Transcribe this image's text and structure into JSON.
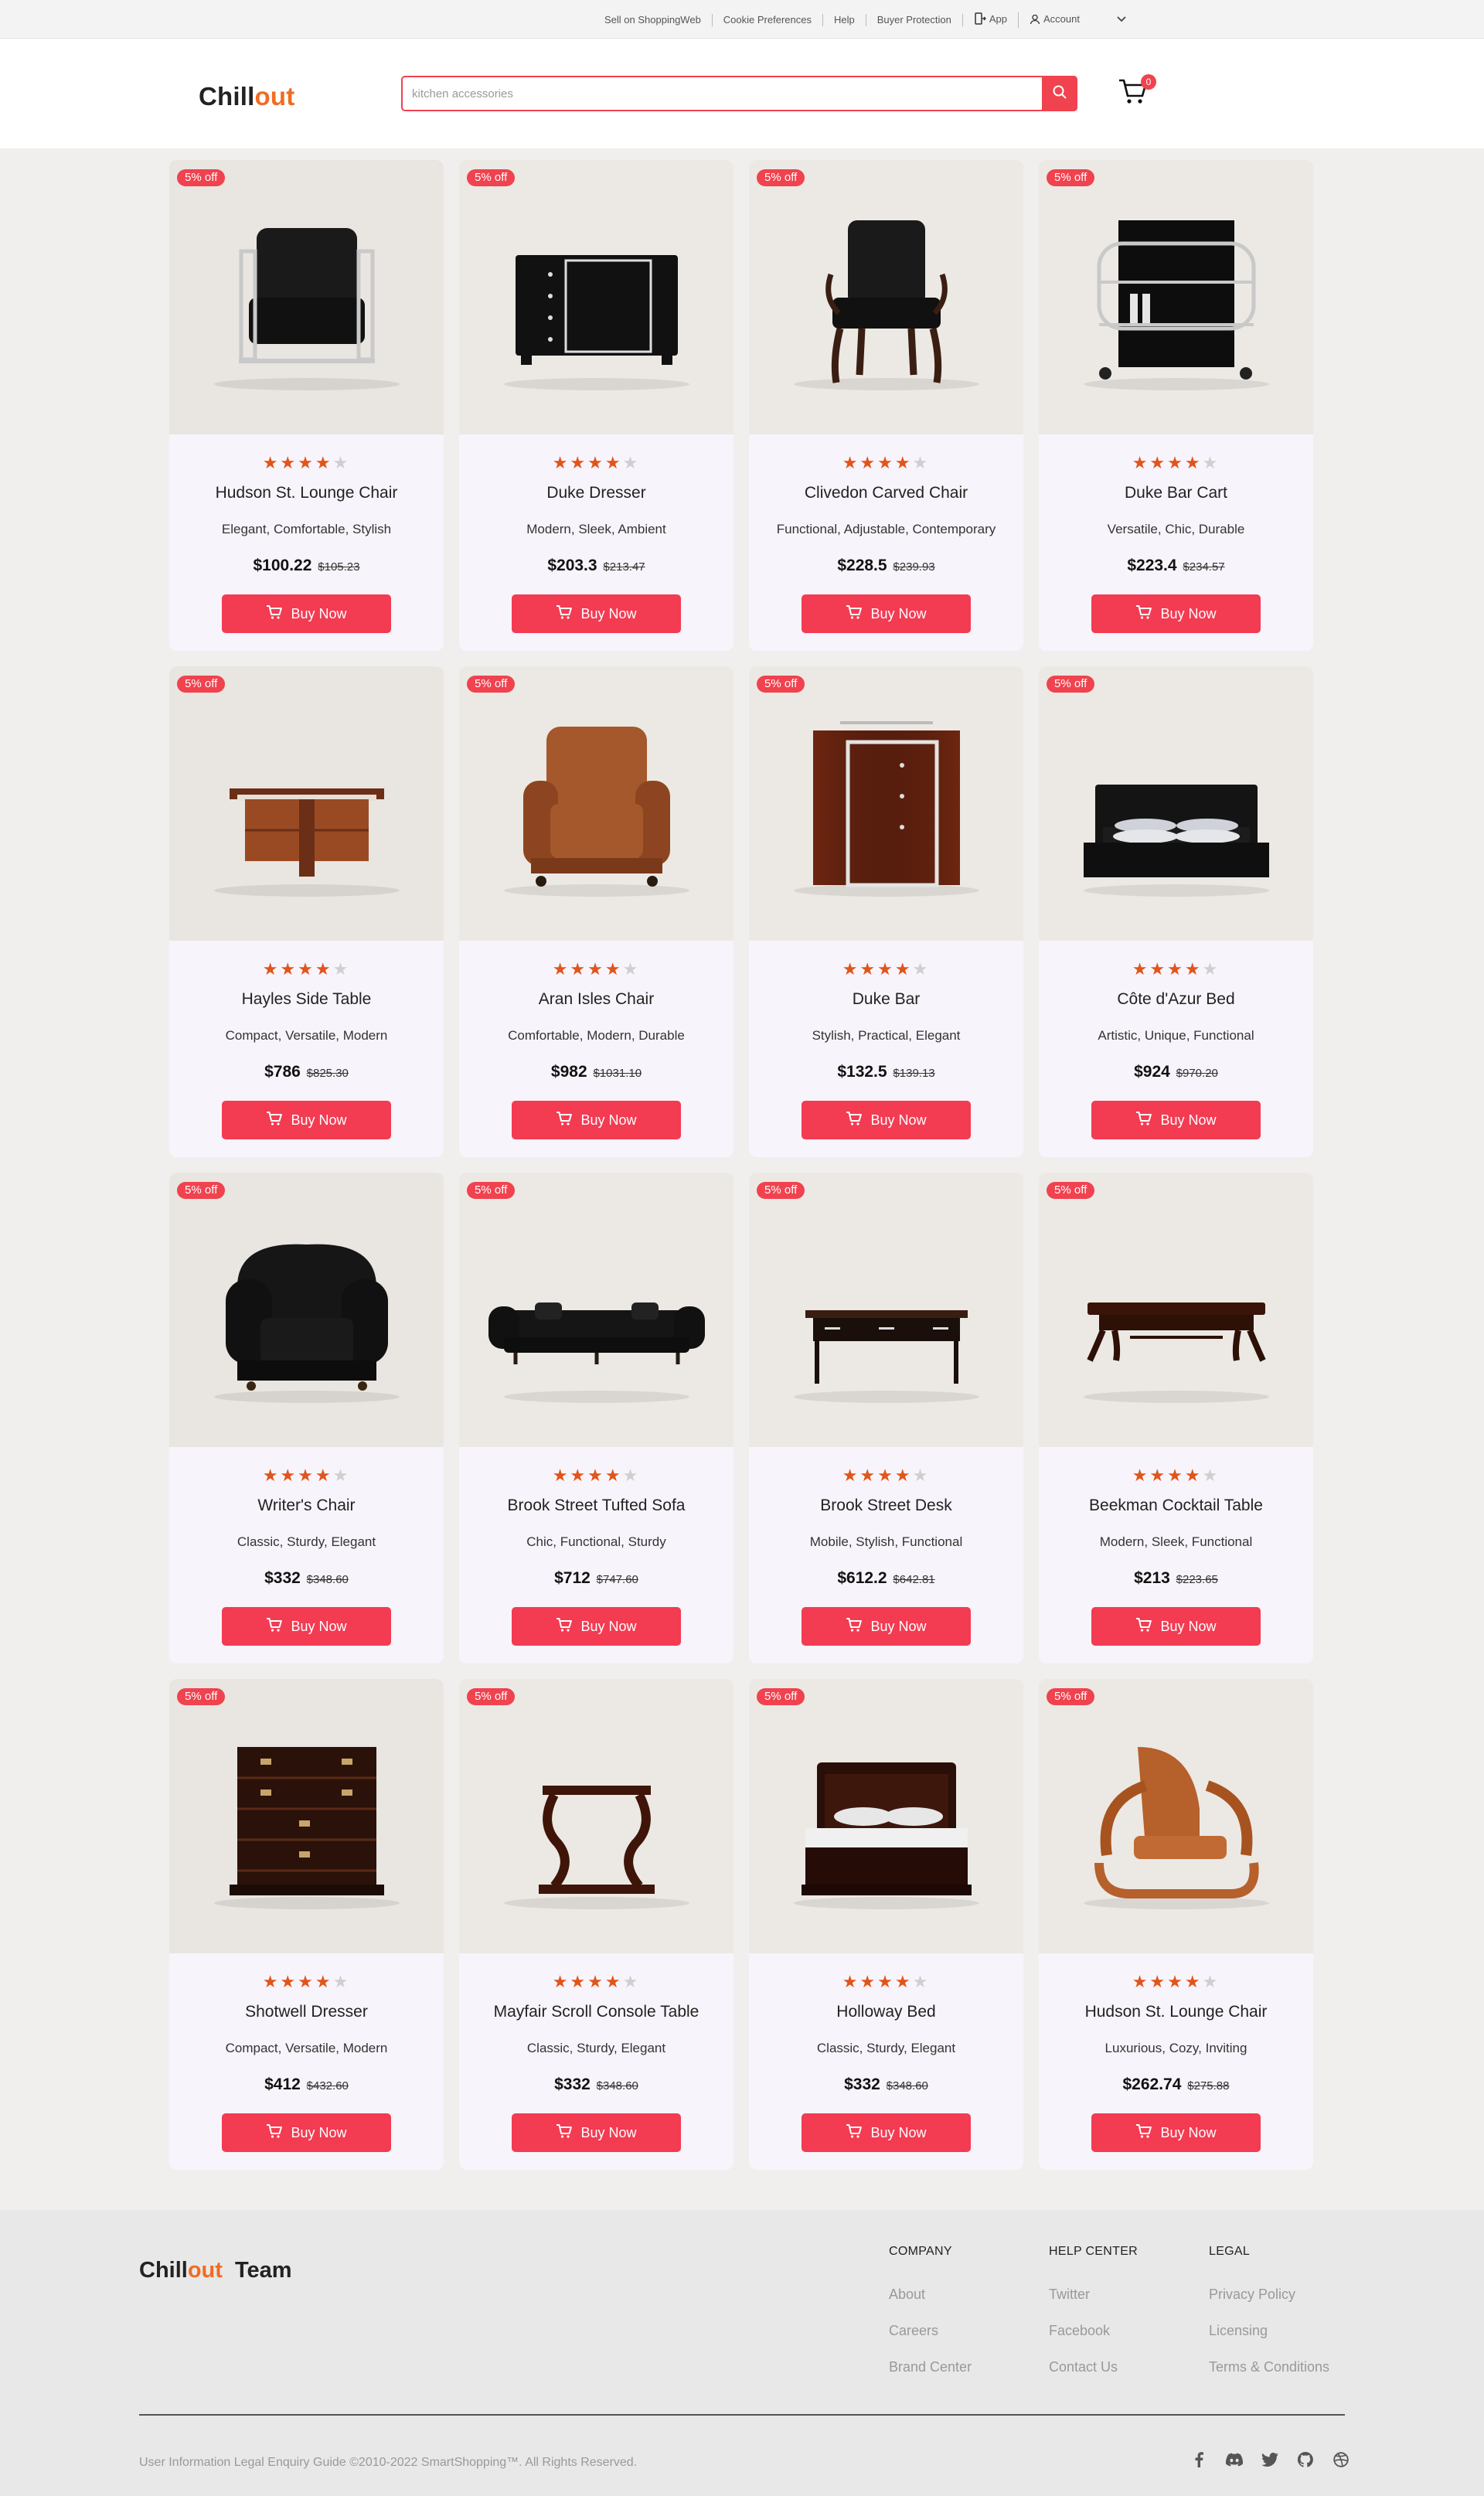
{
  "topbar": {
    "sell": "Sell on ShoppingWeb",
    "cookie": "Cookie Preferences",
    "help": "Help",
    "buyer": "Buyer Protection",
    "app": "App",
    "account": "Account"
  },
  "header": {
    "logo_a": "Chill",
    "logo_b": "out",
    "search_placeholder": "kitchen accessories",
    "cart_count": "0"
  },
  "colors": {
    "accent": "#f33b52",
    "brand_orange": "#f26b21",
    "star": "#e1541a"
  },
  "products": [
    {
      "badge": "5% off",
      "name": "Hudson St. Lounge Chair",
      "tags": "Elegant, Comfortable, Stylish",
      "price": "$100.22",
      "old": "$105.23",
      "rating": 4,
      "buy": "Buy Now",
      "kind": "lounge-black"
    },
    {
      "badge": "5% off",
      "name": "Duke Dresser",
      "tags": "Modern, Sleek, Ambient",
      "price": "$203.3",
      "old": "$213.47",
      "rating": 4,
      "buy": "Buy Now",
      "kind": "dresser-black"
    },
    {
      "badge": "5% off",
      "name": "Clivedon Carved Chair",
      "tags": "Functional, Adjustable, Contemporary",
      "price": "$228.5",
      "old": "$239.93",
      "rating": 4,
      "buy": "Buy Now",
      "kind": "carved-chair"
    },
    {
      "badge": "5% off",
      "name": "Duke Bar Cart",
      "tags": "Versatile, Chic, Durable",
      "price": "$223.4",
      "old": "$234.57",
      "rating": 4,
      "buy": "Buy Now",
      "kind": "bar-cart"
    },
    {
      "badge": "5% off",
      "name": "Hayles Side Table",
      "tags": "Compact, Versatile, Modern",
      "price": "$786",
      "old": "$825.30",
      "rating": 4,
      "buy": "Buy Now",
      "kind": "side-table"
    },
    {
      "badge": "5% off",
      "name": "Aran Isles Chair",
      "tags": "Comfortable, Modern, Durable",
      "price": "$982",
      "old": "$1031.10",
      "rating": 4,
      "buy": "Buy Now",
      "kind": "armchair-brown"
    },
    {
      "badge": "5% off",
      "name": "Duke Bar",
      "tags": "Stylish, Practical, Elegant",
      "price": "$132.5",
      "old": "$139.13",
      "rating": 4,
      "buy": "Buy Now",
      "kind": "bar-cabinet"
    },
    {
      "badge": "5% off",
      "name": "Côte d'Azur Bed",
      "tags": "Artistic, Unique, Functional",
      "price": "$924",
      "old": "$970.20",
      "rating": 4,
      "buy": "Buy Now",
      "kind": "bed-black"
    },
    {
      "badge": "5% off",
      "name": "Writer's Chair",
      "tags": "Classic, Sturdy, Elegant",
      "price": "$332",
      "old": "$348.60",
      "rating": 4,
      "buy": "Buy Now",
      "kind": "tufted-chair"
    },
    {
      "badge": "5% off",
      "name": "Brook Street Tufted Sofa",
      "tags": "Chic, Functional, Sturdy",
      "price": "$712",
      "old": "$747.60",
      "rating": 4,
      "buy": "Buy Now",
      "kind": "sofa"
    },
    {
      "badge": "5% off",
      "name": "Brook Street Desk",
      "tags": "Mobile, Stylish, Functional",
      "price": "$612.2",
      "old": "$642.81",
      "rating": 4,
      "buy": "Buy Now",
      "kind": "desk"
    },
    {
      "badge": "5% off",
      "name": "Beekman Cocktail Table",
      "tags": "Modern, Sleek, Functional",
      "price": "$213",
      "old": "$223.65",
      "rating": 4,
      "buy": "Buy Now",
      "kind": "cocktail-table"
    },
    {
      "badge": "5% off",
      "name": "Shotwell Dresser",
      "tags": "Compact, Versatile, Modern",
      "price": "$412",
      "old": "$432.60",
      "rating": 4,
      "buy": "Buy Now",
      "kind": "chest"
    },
    {
      "badge": "5% off",
      "name": "Mayfair Scroll Console Table",
      "tags": "Classic, Sturdy, Elegant",
      "price": "$332",
      "old": "$348.60",
      "rating": 4,
      "buy": "Buy Now",
      "kind": "console"
    },
    {
      "badge": "5% off",
      "name": "Holloway Bed",
      "tags": "Classic, Sturdy, Elegant",
      "price": "$332",
      "old": "$348.60",
      "rating": 4,
      "buy": "Buy Now",
      "kind": "bed-wood"
    },
    {
      "badge": "5% off",
      "name": "Hudson St. Lounge Chair",
      "tags": "Luxurious, Cozy, Inviting",
      "price": "$262.74",
      "old": "$275.88",
      "rating": 4,
      "buy": "Buy Now",
      "kind": "lounge-tan"
    }
  ],
  "footer": {
    "logo_a": "Chill",
    "logo_b": "out",
    "team": "Team",
    "company": {
      "title": "COMPANY",
      "links": [
        "About",
        "Careers",
        "Brand Center"
      ]
    },
    "help": {
      "title": "HELP CENTER",
      "links": [
        "Twitter",
        "Facebook",
        "Contact Us"
      ]
    },
    "legal": {
      "title": "LEGAL",
      "links": [
        "Privacy Policy",
        "Licensing",
        "Terms & Conditions"
      ]
    },
    "copyright": "User Information Legal Enquiry Guide ©2010-2022 SmartShopping™. All Rights Reserved.",
    "social": [
      "facebook-icon",
      "discord-icon",
      "twitter-icon",
      "github-icon",
      "dribbble-icon"
    ]
  }
}
